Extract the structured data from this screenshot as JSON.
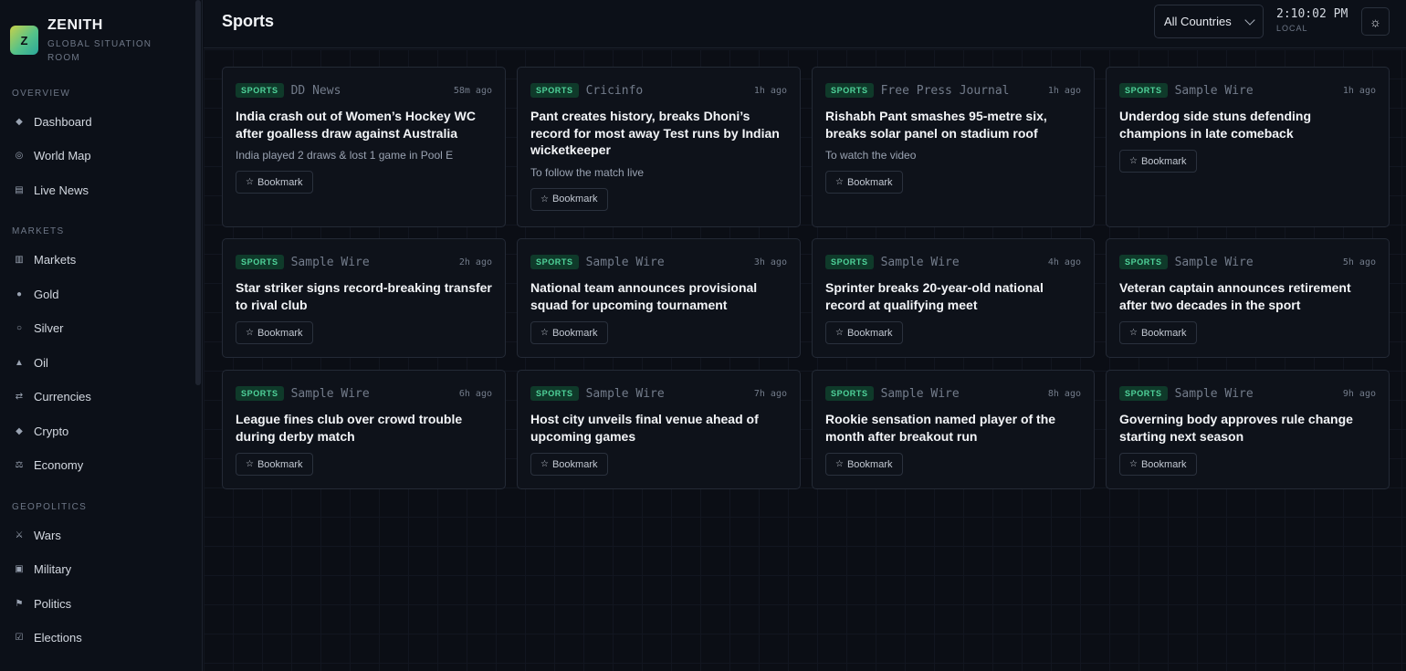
{
  "brand": {
    "logo_letter": "Z",
    "name": "ZENITH",
    "subtitle": "GLOBAL SITUATION ROOM"
  },
  "sidebar": {
    "sections": [
      {
        "label": "OVERVIEW",
        "items": [
          {
            "label": "Dashboard",
            "icon": "◆"
          },
          {
            "label": "World Map",
            "icon": "◎"
          },
          {
            "label": "Live News",
            "icon": "▤"
          }
        ]
      },
      {
        "label": "MARKETS",
        "items": [
          {
            "label": "Markets",
            "icon": "▥"
          },
          {
            "label": "Gold",
            "icon": "●"
          },
          {
            "label": "Silver",
            "icon": "○"
          },
          {
            "label": "Oil",
            "icon": "▲"
          },
          {
            "label": "Currencies",
            "icon": "⇄"
          },
          {
            "label": "Crypto",
            "icon": "◆"
          },
          {
            "label": "Economy",
            "icon": "⚖"
          }
        ]
      },
      {
        "label": "GEOPOLITICS",
        "items": [
          {
            "label": "Wars",
            "icon": "⚔"
          },
          {
            "label": "Military",
            "icon": "▣"
          },
          {
            "label": "Politics",
            "icon": "⚑"
          },
          {
            "label": "Elections",
            "icon": "☑"
          }
        ]
      }
    ]
  },
  "header": {
    "title": "Sports",
    "country_select": "All Countries",
    "clock_time": "2:10:02 PM",
    "clock_label": "LOCAL",
    "theme_icon": "☼"
  },
  "cards": [
    {
      "tag": "SPORTS",
      "source": "DD News",
      "time": "58m ago",
      "headline": "India crash out of Women’s Hockey WC after goalless draw against Australia",
      "summary": "India played 2 draws & lost 1 game in Pool E",
      "bookmark": "Bookmark"
    },
    {
      "tag": "SPORTS",
      "source": "Cricinfo",
      "time": "1h ago",
      "headline": "Pant creates history, breaks Dhoni’s record for most away Test runs by Indian wicketkeeper",
      "summary": "To follow the match live",
      "bookmark": "Bookmark"
    },
    {
      "tag": "SPORTS",
      "source": "Free Press Journal",
      "time": "1h ago",
      "headline": "Rishabh Pant smashes 95-metre six, breaks solar panel on stadium roof",
      "summary": "To watch the video",
      "bookmark": "Bookmark"
    },
    {
      "tag": "SPORTS",
      "source": "Sample Wire",
      "time": "1h ago",
      "headline": "Underdog side stuns defending champions in late comeback",
      "summary": "",
      "bookmark": "Bookmark"
    },
    {
      "tag": "SPORTS",
      "source": "Sample Wire",
      "time": "2h ago",
      "headline": "Star striker signs record-breaking transfer to rival club",
      "summary": "",
      "bookmark": "Bookmark"
    },
    {
      "tag": "SPORTS",
      "source": "Sample Wire",
      "time": "3h ago",
      "headline": "National team announces provisional squad for upcoming tournament",
      "summary": "",
      "bookmark": "Bookmark"
    },
    {
      "tag": "SPORTS",
      "source": "Sample Wire",
      "time": "4h ago",
      "headline": "Sprinter breaks 20-year-old national record at qualifying meet",
      "summary": "",
      "bookmark": "Bookmark"
    },
    {
      "tag": "SPORTS",
      "source": "Sample Wire",
      "time": "5h ago",
      "headline": "Veteran captain announces retirement after two decades in the sport",
      "summary": "",
      "bookmark": "Bookmark"
    },
    {
      "tag": "SPORTS",
      "source": "Sample Wire",
      "time": "6h ago",
      "headline": "League fines club over crowd trouble during derby match",
      "summary": "",
      "bookmark": "Bookmark"
    },
    {
      "tag": "SPORTS",
      "source": "Sample Wire",
      "time": "7h ago",
      "headline": "Host city unveils final venue ahead of upcoming games",
      "summary": "",
      "bookmark": "Bookmark"
    },
    {
      "tag": "SPORTS",
      "source": "Sample Wire",
      "time": "8h ago",
      "headline": "Rookie sensation named player of the month after breakout run",
      "summary": "",
      "bookmark": "Bookmark"
    },
    {
      "tag": "SPORTS",
      "source": "Sample Wire",
      "time": "9h ago",
      "headline": "Governing body approves rule change starting next season",
      "summary": "",
      "bookmark": "Bookmark"
    }
  ],
  "colors": {
    "accent": "#4fd39a",
    "badge_bg": "#0f3a2a",
    "background": "#0b0e15"
  }
}
